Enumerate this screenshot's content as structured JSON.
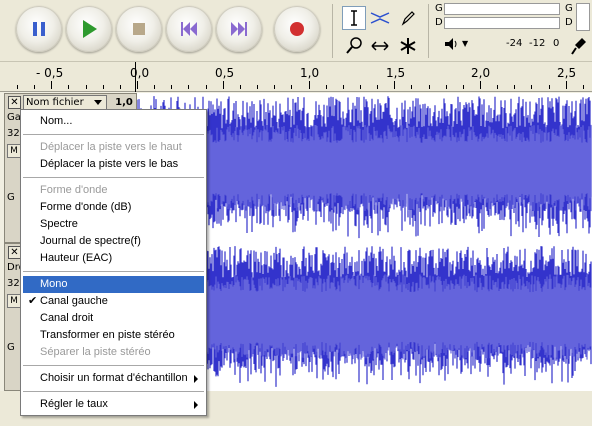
{
  "toolbar": {
    "buttons": [
      {
        "name": "pause",
        "icon": "pause-icon",
        "color": "#3a5fcd"
      },
      {
        "name": "play",
        "icon": "play-icon",
        "color": "#2e9a2e"
      },
      {
        "name": "stop",
        "icon": "stop-icon",
        "color": "#b8a88a"
      },
      {
        "name": "skip-start",
        "icon": "skip-start-icon",
        "color": "#8a6ad0"
      },
      {
        "name": "skip-end",
        "icon": "skip-end-icon",
        "color": "#8a6ad0"
      },
      {
        "name": "record",
        "icon": "record-icon",
        "color": "#d23030"
      }
    ]
  },
  "meters": {
    "play_channel_left": "G",
    "play_channel_right": "G",
    "rec_channel_left": "D",
    "rec_channel_right": "D",
    "ticks": [
      "-24",
      "-12",
      "0"
    ]
  },
  "ruler": {
    "labels": [
      "- 0,5",
      "0,0",
      "0,5",
      "1,0",
      "1,5",
      "2,0",
      "2,5"
    ]
  },
  "tracks": [
    {
      "name": "Nom fichier",
      "gain": "1,0",
      "label_partial": "Ga",
      "rate_partial": "32",
      "mute_partial": "M",
      "extra_partial": "G"
    },
    {
      "name": "",
      "gain": "",
      "label_partial": "Dro",
      "rate_partial": "32",
      "mute_partial": "M",
      "extra_partial": "G"
    }
  ],
  "menu": {
    "items": [
      {
        "label": "Nom...",
        "disabled": false
      },
      {
        "separator": true
      },
      {
        "label": "Déplacer la piste vers le haut",
        "disabled": true
      },
      {
        "label": "Déplacer la piste vers le bas",
        "disabled": false
      },
      {
        "separator": true
      },
      {
        "label": "Forme d'onde",
        "disabled": true
      },
      {
        "label": "Forme d'onde (dB)",
        "disabled": false
      },
      {
        "label": "Spectre",
        "disabled": false
      },
      {
        "label": "Journal de spectre(f)",
        "disabled": false
      },
      {
        "label": "Hauteur (EAC)",
        "disabled": false
      },
      {
        "separator": true
      },
      {
        "label": "Mono",
        "disabled": false,
        "highlighted": true
      },
      {
        "label": "Canal gauche",
        "disabled": false,
        "checked": true
      },
      {
        "label": "Canal droit",
        "disabled": false
      },
      {
        "label": "Transformer en piste stéréo",
        "disabled": false
      },
      {
        "label": "Séparer la piste stéréo",
        "disabled": true
      },
      {
        "separator": true
      },
      {
        "label": "Choisir un format d'échantillon",
        "disabled": false,
        "submenu": true
      },
      {
        "separator": true
      },
      {
        "label": "Régler le taux",
        "disabled": false,
        "submenu": true
      }
    ]
  },
  "colors": {
    "waveform": "#3333cc",
    "menu_highlight": "#316ac5"
  }
}
